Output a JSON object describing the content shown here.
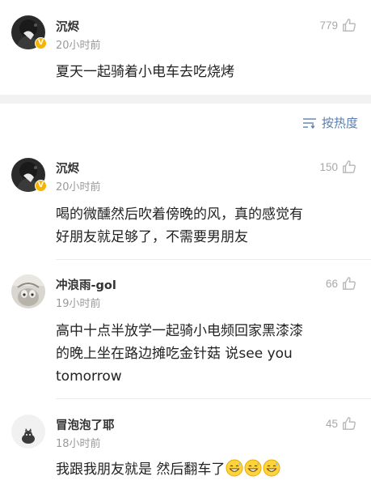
{
  "top_comment": {
    "username": "沉烬",
    "time": "20小时前",
    "likes": "779",
    "text": "夏天一起骑着小电车去吃烧烤",
    "verified_badge": "V"
  },
  "sort": {
    "label": "按热度",
    "icon": "sort-lines-icon"
  },
  "replies": [
    {
      "username": "沉烬",
      "time": "20小时前",
      "likes": "150",
      "text_line1": "喝的微醺然后吹着傍晚的风，真的感觉有",
      "text_line2": "好朋友就足够了，不需要男朋友",
      "verified_badge": "V"
    },
    {
      "username": "冲浪雨-gol",
      "time": "19小时前",
      "likes": "66",
      "text_line1": "高中十点半放学一起骑小电频回家黑漆漆",
      "text_line2": "的晚上坐在路边摊吃金针菇 说see you",
      "text_line3": "tomorrow"
    },
    {
      "username": "冒泡泡了耶",
      "time": "18小时前",
      "likes": "45",
      "text": "我跟我朋友就是 然后翻车了",
      "emoji": "grinning-sweat-emoji"
    }
  ],
  "colors": {
    "link_blue": "#5b7fae",
    "muted": "#9a9a9a",
    "verified": "#f4b400",
    "band": "#f2f2f2"
  }
}
